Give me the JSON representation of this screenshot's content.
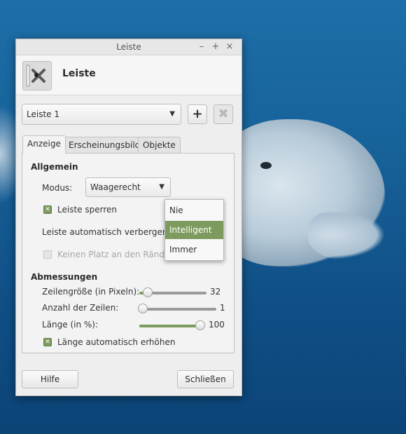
{
  "window": {
    "title": "Leiste",
    "controls": {
      "minimize": "–",
      "maximize": "+",
      "close": "×"
    }
  },
  "header": {
    "title": "Leiste",
    "icon": "panel-settings-icon"
  },
  "panel_select": {
    "value": "Leiste 1",
    "add_label": "+",
    "remove_label": "✖"
  },
  "tabs": [
    {
      "label": "Anzeige",
      "active": true
    },
    {
      "label": "Erscheinungsbild",
      "active": false
    },
    {
      "label": "Objekte",
      "active": false
    }
  ],
  "general": {
    "heading": "Allgemein",
    "mode_label": "Modus:",
    "mode_value": "Waagerecht",
    "lock_label": "Leiste sperren",
    "lock_checked": true,
    "autohide_label": "Leiste automatisch verbergen:",
    "reserve_label": "Keinen Platz an den Rändern",
    "reserve_checked": false
  },
  "dimensions": {
    "heading": "Abmessungen",
    "row_size_label": "Zeilengröße (in Pixeln):",
    "row_size_value": "32",
    "row_size_fraction": 0.12,
    "rows_label": "Anzahl der Zeilen:",
    "rows_value": "1",
    "rows_fraction": 0.0,
    "length_label": "Länge (in %):",
    "length_value": "100",
    "length_fraction": 1.0,
    "autogrow_label": "Länge automatisch erhöhen",
    "autogrow_checked": true
  },
  "footer": {
    "help_label": "Hilfe",
    "close_label": "Schließen"
  },
  "dropdown": {
    "options": [
      "Nie",
      "Intelligent",
      "Immer"
    ],
    "selected": "Intelligent"
  },
  "colors": {
    "accent": "#7d9b5e",
    "window_bg": "#eeeeee"
  }
}
